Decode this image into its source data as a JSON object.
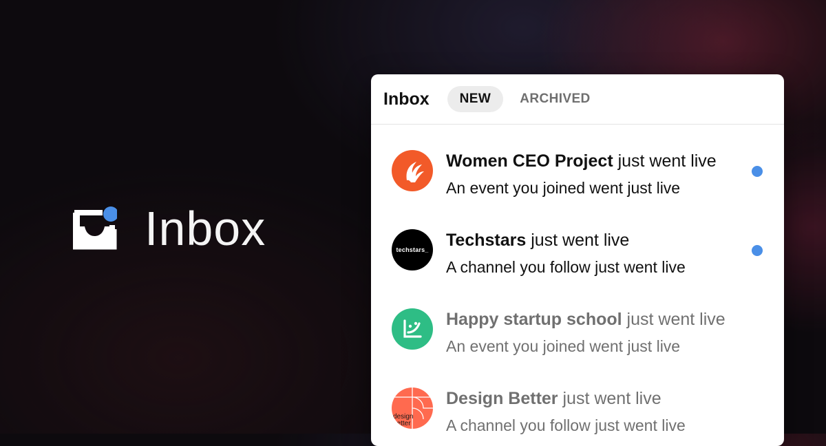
{
  "brand": {
    "label": "Inbox",
    "icon": "inbox-tray-icon",
    "accent_color": "#4a8fe7"
  },
  "panel": {
    "title": "Inbox",
    "tabs": [
      {
        "label": "NEW",
        "active": true
      },
      {
        "label": "ARCHIVED",
        "active": false
      }
    ]
  },
  "notifications": [
    {
      "name": "Women CEO Project",
      "suffix": " just went live",
      "detail": "An event you joined went just live",
      "unread": true,
      "avatar_icon": "women-ceo-project-logo",
      "avatar_color": "#f25a29"
    },
    {
      "name": "Techstars",
      "suffix": " just went live",
      "detail": "A channel you follow just went live",
      "unread": true,
      "avatar_icon": "techstars-logo",
      "avatar_text": "techstars_",
      "avatar_color": "#000000"
    },
    {
      "name": "Happy startup school",
      "suffix": " just went live",
      "detail": "An event you joined went just live",
      "unread": false,
      "avatar_icon": "happy-startup-school-logo",
      "avatar_color": "#2ebd85"
    },
    {
      "name": "Design Better",
      "suffix": " just went live",
      "detail": "A channel you follow just went live",
      "unread": false,
      "avatar_icon": "design-better-logo",
      "avatar_text": "design better",
      "avatar_color": "#ff6a4f"
    }
  ],
  "colors": {
    "unread_dot": "#4a8fe7",
    "read_text": "#707070",
    "unread_text": "#111111"
  }
}
